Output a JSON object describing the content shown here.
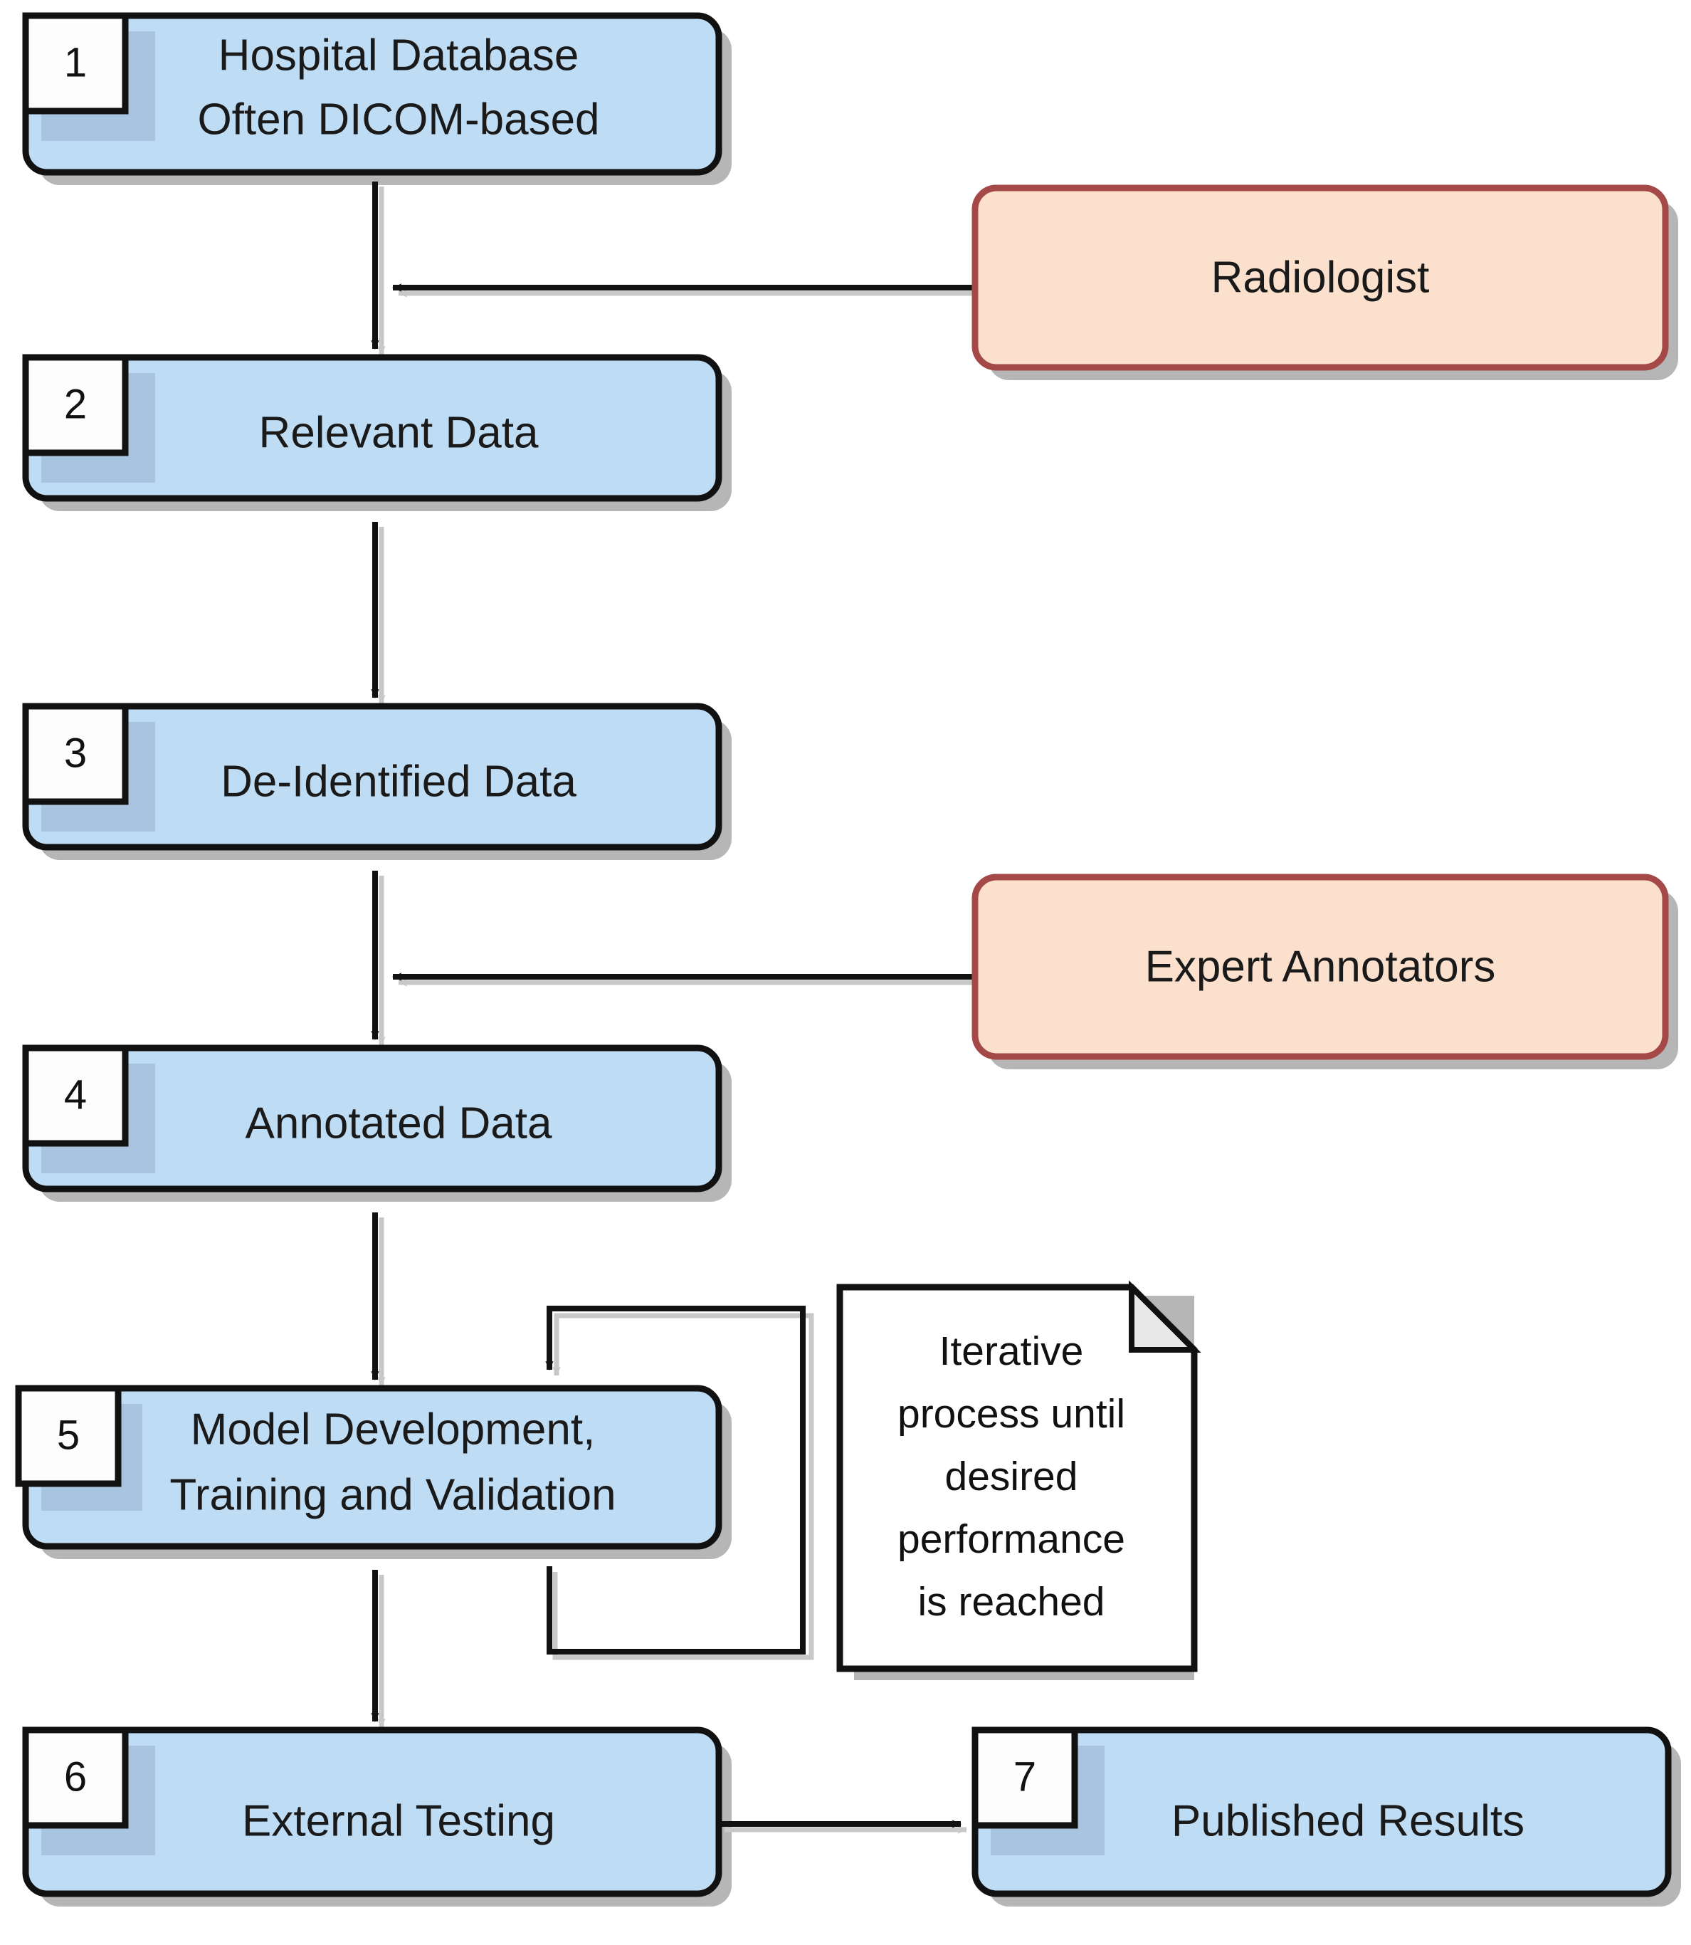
{
  "diagram": {
    "title": "Medical AI Development Pipeline Flowchart",
    "background_color": "#ffffff",
    "palette": {
      "process_fill": "#bfdcf5",
      "process_stroke": "#111111",
      "actor_fill": "#fbe0cd",
      "actor_stroke": "#a54848",
      "note_fill": "#ffffff",
      "note_stroke": "#111111",
      "note_fold_fill": "#e8e8e8",
      "badge_fill": "#fdfdfd",
      "badge_stroke": "#111111",
      "shadow_color": "#b5b5b5",
      "arrow_color": "#111111",
      "arrow_shadow_color": "#c2c2c2",
      "text_color": "#1a1a1a"
    }
  },
  "nodes": [
    {
      "id": "hospital-database",
      "number": "1",
      "kind": "process",
      "lines": [
        "Hospital Database",
        "Often DICOM-based"
      ]
    },
    {
      "id": "relevant-data",
      "number": "2",
      "kind": "process",
      "lines": [
        "Relevant Data"
      ]
    },
    {
      "id": "de-identified-data",
      "number": "3",
      "kind": "process",
      "lines": [
        "De-Identified Data"
      ]
    },
    {
      "id": "annotated-data",
      "number": "4",
      "kind": "process",
      "lines": [
        "Annotated Data"
      ]
    },
    {
      "id": "model-development",
      "number": "5",
      "kind": "process",
      "lines": [
        "Model Development,",
        "Training and Validation"
      ]
    },
    {
      "id": "external-testing",
      "number": "6",
      "kind": "process",
      "lines": [
        "External Testing"
      ]
    },
    {
      "id": "published-results",
      "number": "7",
      "kind": "process",
      "lines": [
        "Published Results"
      ]
    },
    {
      "id": "radiologist",
      "number": "",
      "kind": "actor",
      "lines": [
        "Radiologist"
      ]
    },
    {
      "id": "expert-annotators",
      "number": "",
      "kind": "actor",
      "lines": [
        "Expert Annotators"
      ]
    }
  ],
  "note": {
    "id": "iterative-process-note",
    "lines": [
      "Iterative",
      "process until",
      "desired",
      "performance",
      "is reached"
    ]
  },
  "edges": [
    {
      "id": "edge-1-to-2",
      "from": "hospital-database",
      "to": "relevant-data",
      "direction": "down"
    },
    {
      "id": "edge-2-to-3",
      "from": "relevant-data",
      "to": "de-identified-data",
      "direction": "down"
    },
    {
      "id": "edge-3-to-4",
      "from": "de-identified-data",
      "to": "annotated-data",
      "direction": "down"
    },
    {
      "id": "edge-4-to-5",
      "from": "annotated-data",
      "to": "model-development",
      "direction": "down"
    },
    {
      "id": "edge-5-to-6",
      "from": "model-development",
      "to": "external-testing",
      "direction": "down"
    },
    {
      "id": "edge-6-to-7",
      "from": "external-testing",
      "to": "published-results",
      "direction": "right"
    },
    {
      "id": "edge-radiologist-to-flow",
      "from": "radiologist",
      "to": "edge-1-to-2",
      "direction": "left"
    },
    {
      "id": "edge-annotators-to-flow",
      "from": "expert-annotators",
      "to": "edge-3-to-4",
      "direction": "left"
    },
    {
      "id": "edge-feedback-loop",
      "from": "model-development",
      "to": "model-development",
      "direction": "loop"
    }
  ]
}
